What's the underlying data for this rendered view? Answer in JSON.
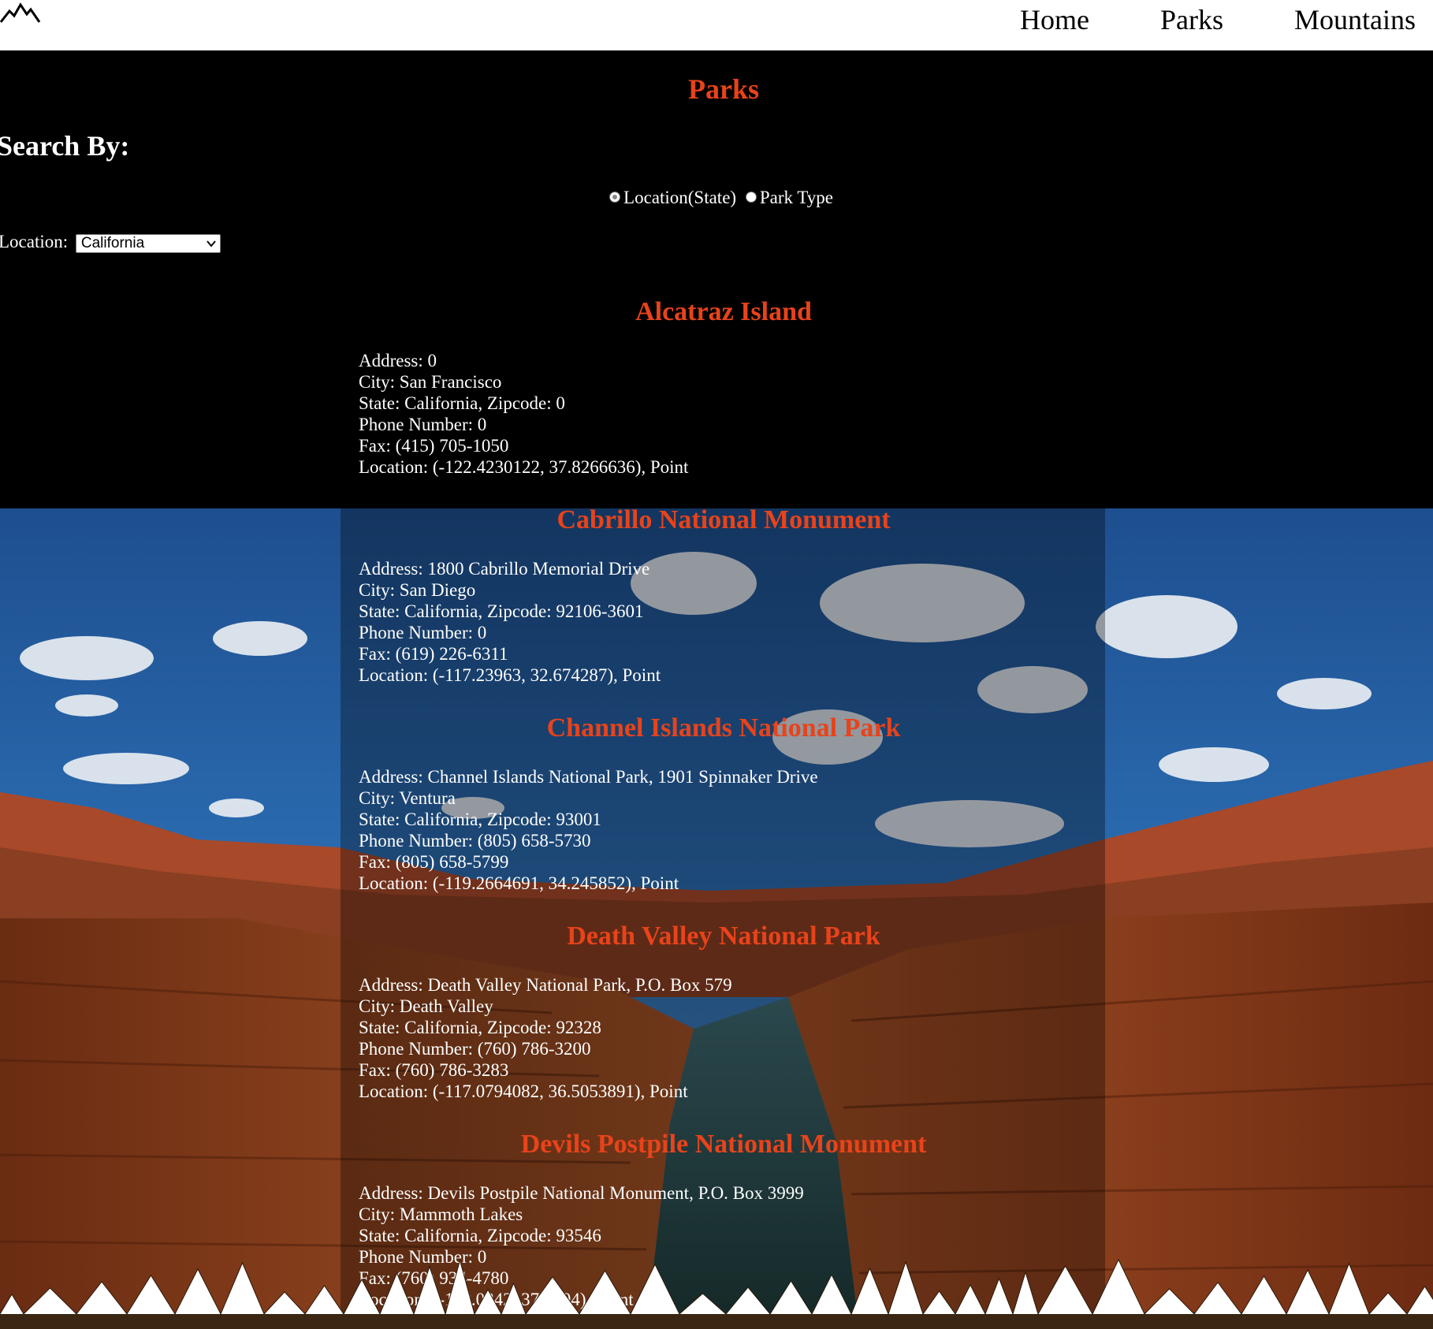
{
  "nav": {
    "logo_icon": "mountain-logo-icon",
    "links": [
      "Home",
      "Parks",
      "Mountains"
    ]
  },
  "page": {
    "title": "Parks",
    "search_heading": "Search By:",
    "radio_options": [
      {
        "label": "Location(State)",
        "checked": true
      },
      {
        "label": "Park Type",
        "checked": false
      }
    ],
    "location_label": "Location:",
    "location_value": "California"
  },
  "parks": [
    {
      "name": "Alcatraz Island",
      "address": "Address: 0",
      "city": "City: San Francisco",
      "state": "State: California, Zipcode: 0",
      "phone": "Phone Number: 0",
      "fax": "Fax: (415) 705-1050",
      "location": "Location: (-122.4230122, 37.8266636), Point"
    },
    {
      "name": "Cabrillo National Monument",
      "address": "Address: 1800 Cabrillo Memorial Drive",
      "city": "City: San Diego",
      "state": "State: California, Zipcode: 92106-3601",
      "phone": "Phone Number: 0",
      "fax": "Fax: (619) 226-6311",
      "location": "Location: (-117.23963, 32.674287), Point"
    },
    {
      "name": "Channel Islands National Park",
      "address": "Address: Channel Islands National Park, 1901 Spinnaker Drive",
      "city": "City: Ventura",
      "state": "State: California, Zipcode: 93001",
      "phone": "Phone Number: (805) 658-5730",
      "fax": "Fax: (805) 658-5799",
      "location": "Location: (-119.2664691, 34.245852), Point"
    },
    {
      "name": "Death Valley National Park",
      "address": "Address: Death Valley National Park, P.O. Box 579",
      "city": "City: Death Valley",
      "state": "State: California, Zipcode: 92328",
      "phone": "Phone Number: (760) 786-3200",
      "fax": "Fax: (760) 786-3283",
      "location": "Location: (-117.0794082, 36.5053891), Point"
    },
    {
      "name": "Devils Postpile National Monument",
      "address": "Address: Devils Postpile National Monument, P.O. Box 3999",
      "city": "City: Mammoth Lakes",
      "state": "State: California, Zipcode: 93546",
      "phone": "Phone Number: 0",
      "fax": "Fax: (760) 934-4780",
      "location": "Location: (-119.0842, 37.6294), Point"
    }
  ],
  "colors": {
    "accent": "#e8431a",
    "background": "#000000",
    "nav_bg": "#ffffff",
    "text": "#ffffff"
  }
}
